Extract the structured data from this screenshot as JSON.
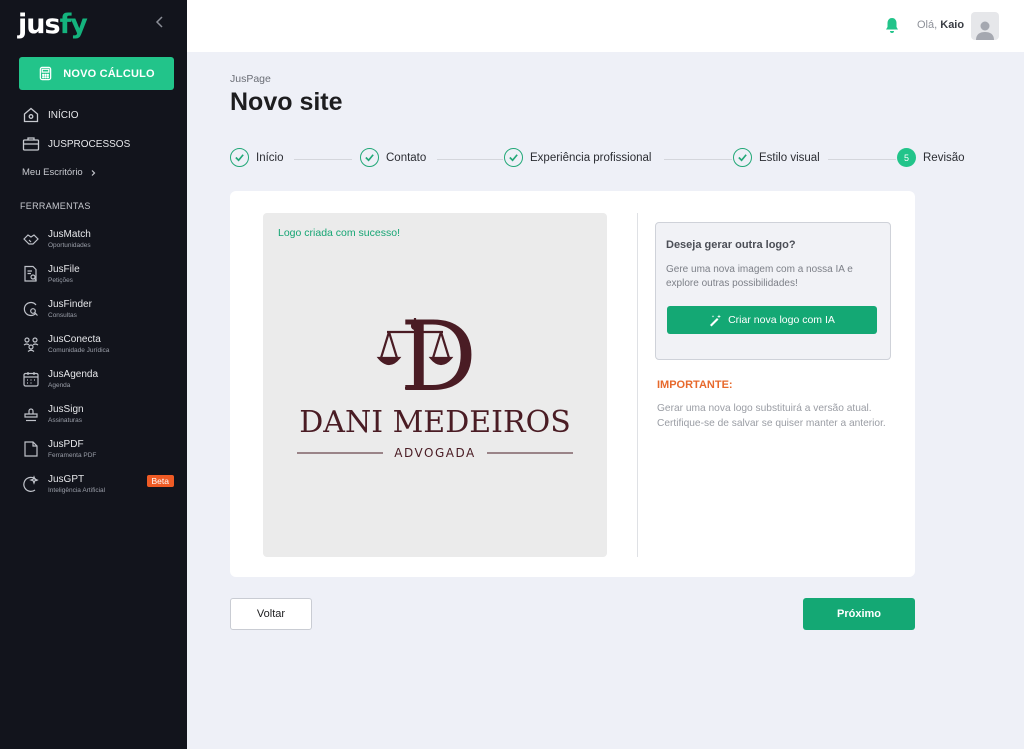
{
  "sidebar": {
    "brand_main": "jus",
    "brand_accent": "fy",
    "new_calc_label": "NOVO CÁLCULO",
    "home_label": "INÍCIO",
    "processes_label": "JUSPROCESSOS",
    "office_label": "Meu Escritório",
    "tools_section": "FERRAMENTAS",
    "tools": [
      {
        "name": "JusMatch",
        "sub": "Oportunidades",
        "icon": "handshake-icon"
      },
      {
        "name": "JusFile",
        "sub": "Petições",
        "icon": "file-search-icon"
      },
      {
        "name": "JusFinder",
        "sub": "Consultas",
        "icon": "finder-icon"
      },
      {
        "name": "JusConecta",
        "sub": "Comunidade Jurídica",
        "icon": "community-icon"
      },
      {
        "name": "JusAgenda",
        "sub": "Agenda",
        "icon": "calendar-icon"
      },
      {
        "name": "JusSign",
        "sub": "Assinaturas",
        "icon": "stamp-icon"
      },
      {
        "name": "JusPDF",
        "sub": "Ferramenta PDF",
        "icon": "pdf-icon"
      },
      {
        "name": "JusGPT",
        "sub": "Inteligência Artificial",
        "icon": "ai-icon",
        "badge": "Beta"
      }
    ]
  },
  "topbar": {
    "greeting": "Olá,",
    "user_name": "Kaio"
  },
  "page": {
    "breadcrumb": "JusPage",
    "title": "Novo site"
  },
  "steps": [
    {
      "label": "Início",
      "state": "done"
    },
    {
      "label": "Contato",
      "state": "done"
    },
    {
      "label": "Experiência profissional",
      "state": "done"
    },
    {
      "label": "Estilo visual",
      "state": "done"
    },
    {
      "label": "Revisão",
      "state": "current",
      "number": "5"
    }
  ],
  "preview": {
    "success_text": "Logo criada com sucesso!",
    "logo_name": "DANI MEDEIROS",
    "logo_subtitle": "ADVOGADA",
    "logo_monogram": "D"
  },
  "regenerate": {
    "heading": "Deseja gerar outra logo?",
    "text": "Gere uma nova imagem com a nossa IA e explore outras possibilidades!",
    "button_label": "Criar nova logo com IA"
  },
  "important": {
    "title": "IMPORTANTE:",
    "text": "Gerar uma nova logo substituirá a versão atual. Certifique-se de salvar se quiser manter a anterior."
  },
  "footer": {
    "back_label": "Voltar",
    "next_label": "Próximo"
  },
  "colors": {
    "accent": "#22c48a",
    "accent_dark": "#14a874",
    "sidebar_bg": "#12141c",
    "warning": "#e7692c",
    "logo_color": "#4a1c24"
  }
}
